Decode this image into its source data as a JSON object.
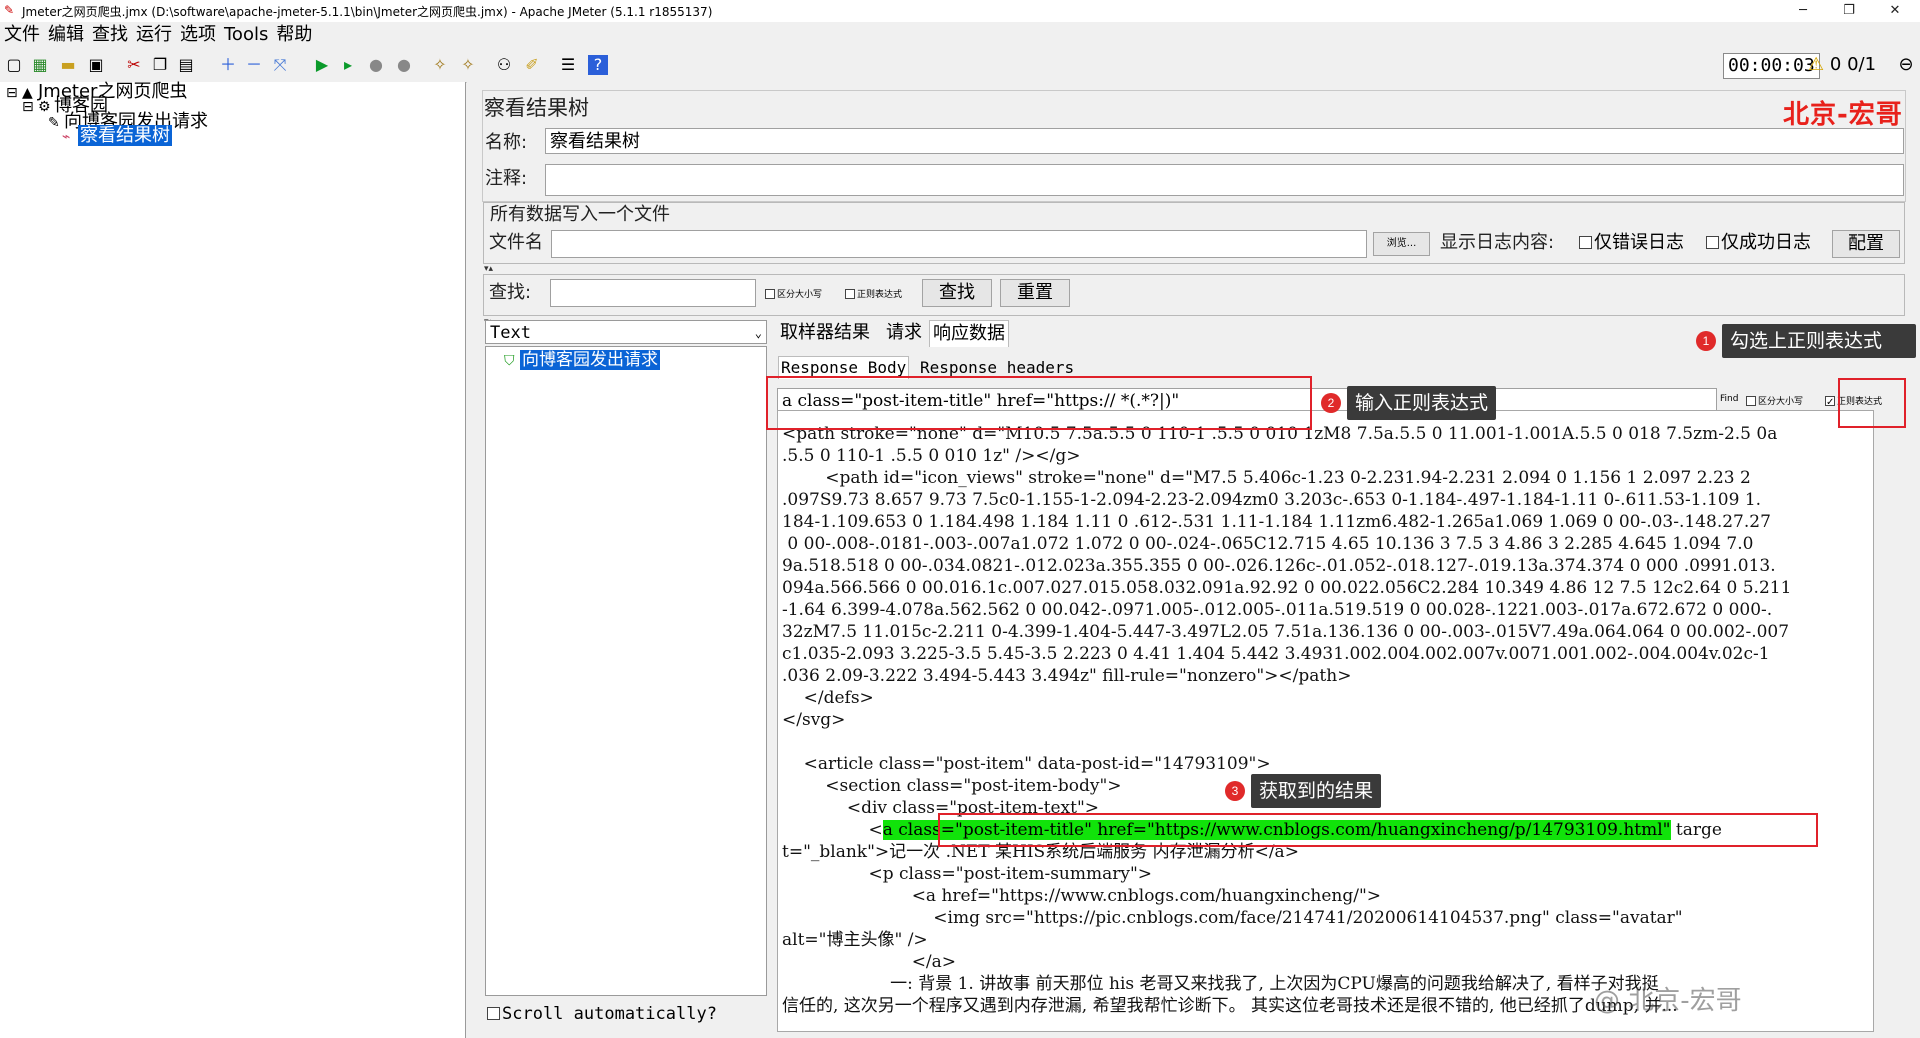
{
  "window": {
    "title": "Jmeter之网页爬虫.jmx (D:\\software\\apache-jmeter-5.1.1\\bin\\Jmeter之网页爬虫.jmx) - Apache JMeter (5.1.1 r1855137)",
    "minimize": "─",
    "restore": "❐",
    "close": "✕"
  },
  "menu": [
    "文件",
    "编辑",
    "查找",
    "运行",
    "选项",
    "Tools",
    "帮助"
  ],
  "toolbar": {
    "timer": "00:00:03",
    "warnings": "0",
    "threads": "0/1"
  },
  "tree": {
    "root": "Jmeter之网页爬虫",
    "group": "博客园",
    "sampler": "向博客园发出请求",
    "listener": "察看结果树"
  },
  "panel": {
    "heading": "察看结果树",
    "brand": "北京-宏哥",
    "name_label": "名称:",
    "name_value": "察看结果树",
    "comment_label": "注释:",
    "comment_value": "",
    "file_section_title": "所有数据写入一个文件",
    "filename_label": "文件名",
    "filename_value": "",
    "browse_label": "浏览...",
    "log_label": "显示日志内容:",
    "errors_only": "仅错误日志",
    "success_only": "仅成功日志",
    "config_button": "配置",
    "search_label": "查找:",
    "search_value": "",
    "case_sensitive": "区分大小写",
    "regex": "正则表达式",
    "find_button": "查找",
    "reset_button": "重置"
  },
  "results": {
    "renderer": "Text",
    "items": [
      "向博客园发出请求"
    ],
    "scroll_auto": "Scroll automatically?"
  },
  "tabs": [
    "取样器结果",
    "请求",
    "响应数据"
  ],
  "subtabs": [
    "Response Body",
    "Response headers"
  ],
  "responseSearch": {
    "value": "a class=\"post-item-title\" href=\"https:// *(.*?|)\"",
    "find_label": "Find",
    "case_sensitive": "区分大小写",
    "regex": "正则表达式"
  },
  "annotations": {
    "step1": "勾选上正则表达式",
    "step2": "输入正则表达式",
    "step3": "获取到的结果",
    "n1": "1",
    "n2": "2",
    "n3": "3"
  },
  "code": {
    "line01": "<path stroke=\"none\" d=\"M10.5 7.5a.5.5 0 110-1 .5.5 0 010 1zM8 7.5a.5.5 0 11.001-1.001A.5.5 0 018 7.5zm-2.5 0a",
    "line02": ".5.5 0 110-1 .5.5 0 010 1z\" /></g>",
    "line03": "        <path id=\"icon_views\" stroke=\"none\" d=\"M7.5 5.406c-1.23 0-2.231.94-2.231 2.094 0 1.156 1 2.097 2.23 2",
    "line04": ".097S9.73 8.657 9.73 7.5c0-1.155-1-2.094-2.23-2.094zm0 3.203c-.653 0-1.184-.497-1.184-1.11 0-.611.53-1.109 1.",
    "line05": "184-1.109.653 0 1.184.498 1.184 1.11 0 .612-.531 1.11-1.184 1.11zm6.482-1.265a1.069 1.069 0 00-.03-.148.27.27",
    "line06": " 0 00-.008-.0181-.003-.007a1.072 1.072 0 00-.024-.065C12.715 4.65 10.136 3 7.5 3 4.86 3 2.285 4.645 1.094 7.0",
    "line07": "9a.518.518 0 00-.034.0821-.012.023a.355.355 0 00-.026.126c-.01.052-.018.127-.019.13a.374.374 0 000 .0991.013.",
    "line08": "094a.566.566 0 00.016.1c.007.027.015.058.032.091a.92.92 0 00.022.056C2.284 10.349 4.86 12 7.5 12c2.64 0 5.211",
    "line09": "-1.64 6.399-4.078a.562.562 0 00.042-.0971.005-.012.005-.011a.519.519 0 00.028-.1221.003-.017a.672.672 0 000-.",
    "line10": "32zM7.5 11.015c-2.211 0-4.399-1.404-5.447-3.497L2.05 7.51a.136.136 0 00-.003-.015V7.49a.064.064 0 00.002-.007",
    "line11": "c1.035-2.093 3.225-3.5 5.45-3.5 2.223 0 4.41 1.404 5.442 3.4931.002.004.002.007v.0071.001.002-.004.004v.02c-1",
    "line12": ".036 2.09-3.222 3.494-5.443 3.494z\" fill-rule=\"nonzero\"></path>",
    "line13": "    </defs>",
    "line14": "</svg>",
    "line15": "",
    "line16": "    <article class=\"post-item\" data-post-id=\"14793109\">",
    "line17": "        <section class=\"post-item-body\">",
    "line18": "            <div class=\"post-item-text\">",
    "line19_pre": "                <",
    "line19_hl": "a class=\"post-item-title\" href=\"https://www.cnblogs.com/huangxincheng/p/14793109.html\"",
    "line19_post": " targe",
    "line20": "t=\"_blank\">记一次 .NET 某HIS系统后端服务 内存泄漏分析</a>",
    "line21": "                <p class=\"post-item-summary\">",
    "line22": "                        <a href=\"https://www.cnblogs.com/huangxincheng/\">",
    "line23": "                            <img src=\"https://pic.cnblogs.com/face/214741/20200614104537.png\" class=\"avatar\"",
    "line24": "alt=\"博主头像\" />",
    "line25": "                        </a>",
    "line26": "                    一: 背景 1. 讲故事 前天那位 his 老哥又来找我了, 上次因为CPU爆高的问题我给解决了, 看样子对我挺",
    "line27": "信任的, 这次另一个程序又遇到内存泄漏, 希望我帮忙诊断下。 其实这位老哥技术还是很不错的, 他已经抓了dump, 并..."
  },
  "watermark": "@ 北京-宏哥"
}
